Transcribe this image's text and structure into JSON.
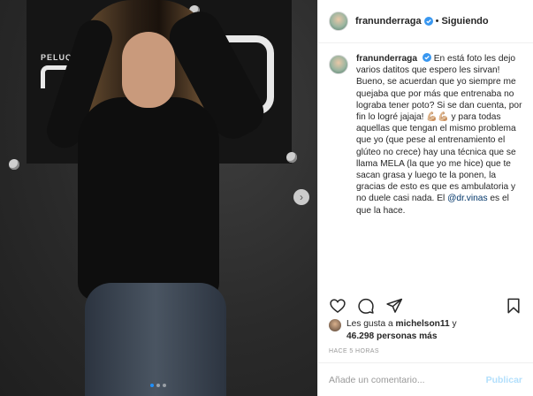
{
  "post": {
    "photo": {
      "sign_text": "PELUQ",
      "carousel_dots": 3,
      "active_dot": 1
    },
    "header": {
      "username": "franunderraga",
      "separator": "•",
      "follow_label": "Siguiendo"
    },
    "caption": {
      "username": "franunderraga",
      "text_1": "En está foto les dejo varios datitos que espero les sirvan! Bueno, se acuerdan que yo siempre me quejaba que por más que entrenaba no lograba tener poto? Si se dan cuenta, por fin lo logré jajaja! ",
      "emoji": "💪🏼💪🏼",
      "text_2": " y para todas aquellas que tengan el mismo problema que yo (que pese al entrenamiento el glúteo no crece) hay una técnica que se llama MELA (la que yo me hice) que te sacan grasa y luego te la ponen, la gracias de esto es que es ambulatoria y no duele casi nada. El ",
      "mention": "@dr.vinas",
      "text_3": " es el que la hace."
    },
    "likes": {
      "prefix": "Les gusta a ",
      "user": "michelson11",
      "middle": " y",
      "count": "46.298 personas más"
    },
    "time": "HACE 5 HORAS",
    "comment": {
      "placeholder": "Añade un comentario...",
      "publish_label": "Publicar"
    },
    "colors": {
      "verified": "#3897f0",
      "mention": "#003569",
      "publish_disabled": "#b2dffc"
    },
    "icons": [
      "heart-icon",
      "comment-icon",
      "share-icon",
      "bookmark-icon",
      "verified-badge-icon",
      "chevron-right-icon"
    ]
  }
}
